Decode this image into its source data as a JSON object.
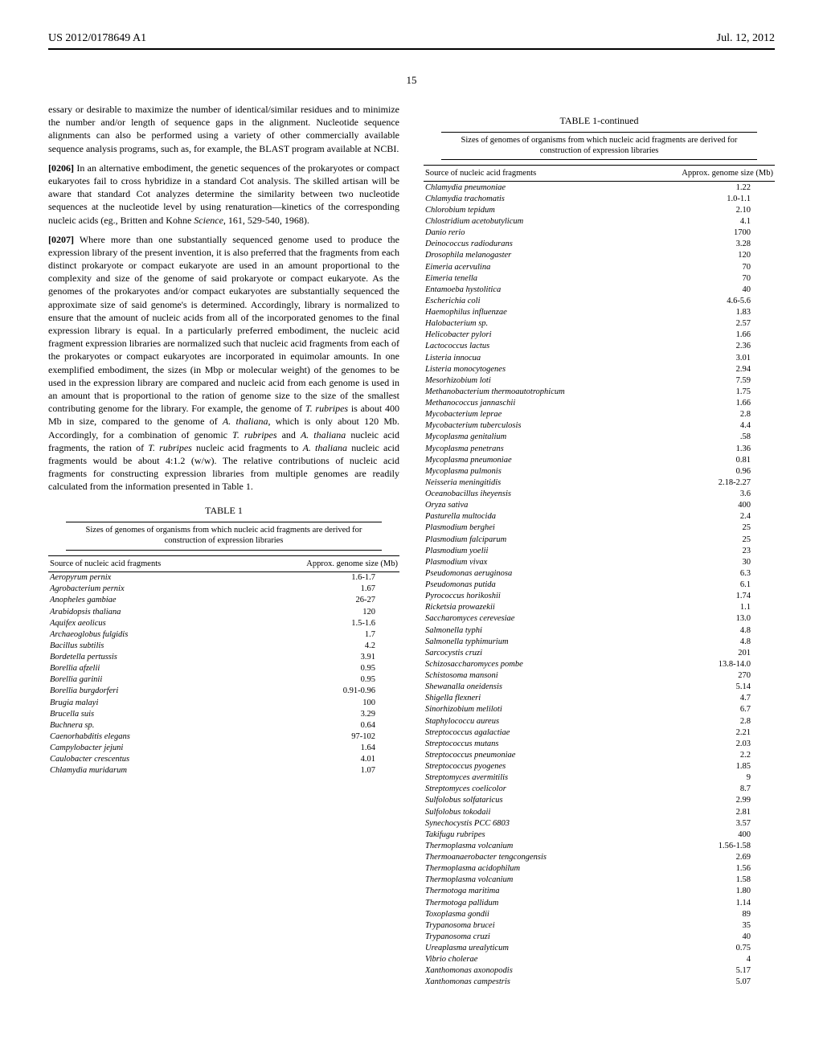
{
  "header": {
    "docNumber": "US 2012/0178649 A1",
    "date": "Jul. 12, 2012",
    "pageNumber": "15"
  },
  "leftColumn": {
    "lead": "essary or desirable to maximize the number of identical/similar residues and to minimize the number and/or length of sequence gaps in the alignment. Nucleotide sequence alignments can also be performed using a variety of other commercially available sequence analysis programs, such as, for example, the BLAST program available at NCBI.",
    "p0206_num": "[0206]",
    "p0206_text": " In an alternative embodiment, the genetic sequences of the prokaryotes or compact eukaryotes fail to cross hybridize in a standard Cot analysis. The skilled artisan will be aware that standard Cot analyzes determine the similarity between two nucleotide sequences at the nucleotide level by using renaturation—kinetics of the corresponding nucleic acids (eg., Britten and Kohne ",
    "p0206_cite": "Science,",
    "p0206_tail": " 161, 529-540, 1968).",
    "p0207_num": "[0207]",
    "p0207_text": " Where more than one substantially sequenced genome used to produce the expression library of the present invention, it is also preferred that the fragments from each distinct prokaryote or compact eukaryote are used in an amount proportional to the complexity and size of the genome of said prokaryote or compact eukaryote. As the genomes of the prokaryotes and/or compact eukaryotes are substantially sequenced the approximate size of said genome's is determined. Accordingly, library is normalized to ensure that the amount of nucleic acids from all of the incorporated genomes to the final expression library is equal. In a particularly preferred embodiment, the nucleic acid fragment expression libraries are normalized such that nucleic acid fragments from each of the prokaryotes or compact eukaryotes are incorporated in equimolar amounts. In one exemplified embodiment, the sizes (in Mbp or molecular weight) of the genomes to be used in the expression library are compared and nucleic acid from each genome is used in an amount that is proportional to the ration of genome size to the size of the smallest contributing genome for the library. For example, the genome of ",
    "p0207_sp1": "T. rubripes",
    "p0207_mid1": " is about 400 Mb in size, compared to the genome of ",
    "p0207_sp2": "A. thaliana",
    "p0207_mid2": ", which is only about 120 Mb. Accordingly, for a combination of genomic ",
    "p0207_sp3": "T. rubripes",
    "p0207_mid3": " and ",
    "p0207_sp4": "A. thaliana",
    "p0207_mid4": " nucleic acid fragments, the ration of ",
    "p0207_sp5": "T. rubripes",
    "p0207_mid5": " nucleic acid fragments to ",
    "p0207_sp6": "A. thaliana",
    "p0207_mid6": " nucleic acid fragments would be about 4:1.2 (w/w). The relative contributions of nucleic acid fragments for constructing expression libraries from multiple genomes are readily calculated from the information presented in Table 1."
  },
  "table1": {
    "title": "TABLE 1",
    "caption": "Sizes of genomes of organisms from which nucleic acid fragments are derived for construction of expression libraries",
    "colSource": "Source of nucleic acid fragments",
    "colSize": "Approx. genome size (Mb)",
    "rows": [
      {
        "organism": "Aeropyrum pernix",
        "size": "1.6-1.7"
      },
      {
        "organism": "Agrobacterium pernix",
        "size": "1.67"
      },
      {
        "organism": "Anopheles gambiae",
        "size": "26-27"
      },
      {
        "organism": "Arabidopsis thaliana",
        "size": "120"
      },
      {
        "organism": "Aquifex aeolicus",
        "size": "1.5-1.6"
      },
      {
        "organism": "Archaeoglobus fulgidis",
        "size": "1.7"
      },
      {
        "organism": "Bacillus subtilis",
        "size": "4.2"
      },
      {
        "organism": "Bordetella pertussis",
        "size": "3.91"
      },
      {
        "organism": "Borellia afzelii",
        "size": "0.95"
      },
      {
        "organism": "Borellia garinii",
        "size": "0.95"
      },
      {
        "organism": "Borellia burgdorferi",
        "size": "0.91-0.96"
      },
      {
        "organism": "Brugia malayi",
        "size": "100"
      },
      {
        "organism": "Brucella suis",
        "size": "3.29"
      },
      {
        "organism": "Buchnera sp.",
        "size": "0.64"
      },
      {
        "organism": "Caenorhabditis elegans",
        "size": "97-102"
      },
      {
        "organism": "Campylobacter jejuni",
        "size": "1.64"
      },
      {
        "organism": "Caulobacter crescentus",
        "size": "4.01"
      },
      {
        "organism": "Chlamydia muridarum",
        "size": "1.07"
      }
    ]
  },
  "table1cont": {
    "title": "TABLE 1-continued",
    "caption": "Sizes of genomes of organisms from which nucleic acid fragments are derived for construction of expression libraries",
    "colSource": "Source of nucleic acid fragments",
    "colSize": "Approx. genome size (Mb)",
    "rows": [
      {
        "organism": "Chlamydia pneumoniae",
        "size": "1.22"
      },
      {
        "organism": "Chlamydia trachomatis",
        "size": "1.0-1.1"
      },
      {
        "organism": "Chlorobium tepidum",
        "size": "2.10"
      },
      {
        "organism": "Chlostridium acetobutylicum",
        "size": "4.1"
      },
      {
        "organism": "Danio rerio",
        "size": "1700"
      },
      {
        "organism": "Deinococcus radiodurans",
        "size": "3.28"
      },
      {
        "organism": "Drosophila melanogaster",
        "size": "120"
      },
      {
        "organism": "Eimeria acervulina",
        "size": "70"
      },
      {
        "organism": "Eimeria tenella",
        "size": "70"
      },
      {
        "organism": "Entamoeba hystolitica",
        "size": "40"
      },
      {
        "organism": "Escherichia coli",
        "size": "4.6-5.6"
      },
      {
        "organism": "Haemophilus influenzae",
        "size": "1.83"
      },
      {
        "organism": "Halobacterium sp.",
        "size": "2.57"
      },
      {
        "organism": "Helicobacter pylori",
        "size": "1.66"
      },
      {
        "organism": "Lactococcus lactus",
        "size": "2.36"
      },
      {
        "organism": "Listeria innocua",
        "size": "3.01"
      },
      {
        "organism": "Listeria monocytogenes",
        "size": "2.94"
      },
      {
        "organism": "Mesorhizobium loti",
        "size": "7.59"
      },
      {
        "organism": "Methanobacterium thermoautotrophicum",
        "size": "1.75"
      },
      {
        "organism": "Methanococcus jannaschii",
        "size": "1.66"
      },
      {
        "organism": "Mycobacterium leprae",
        "size": "2.8"
      },
      {
        "organism": "Mycobacterium tuberculosis",
        "size": "4.4"
      },
      {
        "organism": "Mycoplasma genitalium",
        "size": ".58"
      },
      {
        "organism": "Mycoplasma penetrans",
        "size": "1.36"
      },
      {
        "organism": "Mycoplasma pneumoniae",
        "size": "0.81"
      },
      {
        "organism": "Mycoplasma pulmonis",
        "size": "0.96"
      },
      {
        "organism": "Neisseria meningitidis",
        "size": "2.18-2.27"
      },
      {
        "organism": "Oceanobacillus iheyensis",
        "size": "3.6"
      },
      {
        "organism": "Oryza sativa",
        "size": "400"
      },
      {
        "organism": "Pasturella multocida",
        "size": "2.4"
      },
      {
        "organism": "Plasmodium berghei",
        "size": "25"
      },
      {
        "organism": "Plasmodium falciparum",
        "size": "25"
      },
      {
        "organism": "Plasmodium yoelii",
        "size": "23"
      },
      {
        "organism": "Plasmodium vivax",
        "size": "30"
      },
      {
        "organism": "Pseudomonas aeruginosa",
        "size": "6.3"
      },
      {
        "organism": "Pseudomonas putida",
        "size": "6.1"
      },
      {
        "organism": "Pyrococcus horikoshii",
        "size": "1.74"
      },
      {
        "organism": "Ricketsia prowazekii",
        "size": "1.1"
      },
      {
        "organism": "Saccharomyces cerevesiae",
        "size": "13.0"
      },
      {
        "organism": "Salmonella typhi",
        "size": "4.8"
      },
      {
        "organism": "Salmonella typhimurium",
        "size": "4.8"
      },
      {
        "organism": "Sarcocystis cruzi",
        "size": "201"
      },
      {
        "organism": "Schizosaccharomyces pombe",
        "size": "13.8-14.0"
      },
      {
        "organism": "Schistosoma mansoni",
        "size": "270"
      },
      {
        "organism": "Shewanalla oneidensis",
        "size": "5.14"
      },
      {
        "organism": "Shigella flexneri",
        "size": "4.7"
      },
      {
        "organism": "Sinorhizobium meliloti",
        "size": "6.7"
      },
      {
        "organism": "Staphylococcu aureus",
        "size": "2.8"
      },
      {
        "organism": "Streptococcus agalactiae",
        "size": "2.21"
      },
      {
        "organism": "Streptococcus mutans",
        "size": "2.03"
      },
      {
        "organism": "Streptococcus pneumoniae",
        "size": "2.2"
      },
      {
        "organism": "Streptococcus pyogenes",
        "size": "1.85"
      },
      {
        "organism": "Streptomyces avermitilis",
        "size": "9"
      },
      {
        "organism": "Streptomyces coelicolor",
        "size": "8.7"
      },
      {
        "organism": "Sulfolobus solfataricus",
        "size": "2.99"
      },
      {
        "organism": "Sulfolobus tokodaii",
        "size": "2.81"
      },
      {
        "organism": "Synechocystis PCC 6803",
        "size": "3.57"
      },
      {
        "organism": "Takifugu rubripes",
        "size": "400"
      },
      {
        "organism": "Thermoplasma volcanium",
        "size": "1.56-1.58"
      },
      {
        "organism": "Thermoanaerobacter tengcongensis",
        "size": "2.69"
      },
      {
        "organism": "Thermoplasma acidophilum",
        "size": "1.56"
      },
      {
        "organism": "Thermoplasma volcanium",
        "size": "1.58"
      },
      {
        "organism": "Thermotoga maritima",
        "size": "1.80"
      },
      {
        "organism": "Thermotoga pallidum",
        "size": "1.14"
      },
      {
        "organism": "Toxoplasma gondii",
        "size": "89"
      },
      {
        "organism": "Trypanosoma brucei",
        "size": "35"
      },
      {
        "organism": "Trypanosoma cruzi",
        "size": "40"
      },
      {
        "organism": "Ureaplasma urealyticum",
        "size": "0.75"
      },
      {
        "organism": "Vibrio cholerae",
        "size": "4"
      },
      {
        "organism": "Xanthomonas axonopodis",
        "size": "5.17"
      },
      {
        "organism": "Xanthomonas campestris",
        "size": "5.07"
      }
    ]
  }
}
